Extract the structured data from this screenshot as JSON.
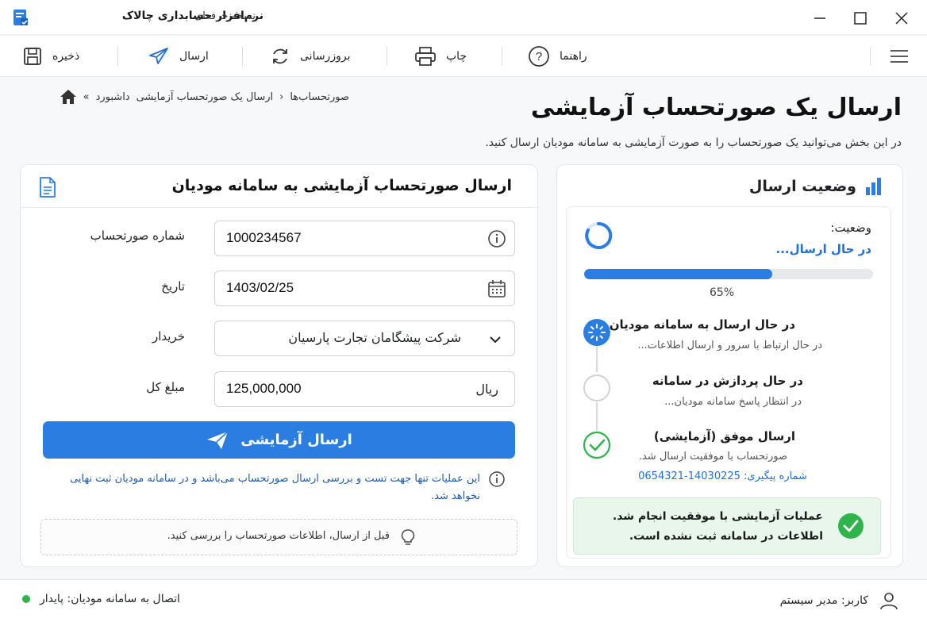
{
  "window": {
    "title": "نرم‌افزار حسابداری چالاک",
    "edition": "نسخه حرفه‌ای"
  },
  "toolbar": {
    "save": "ذخیره",
    "send": "ارسال",
    "update": "بروزرسانی",
    "print": "چاپ",
    "help": "راهنما"
  },
  "breadcrumb": {
    "items": [
      "داشبورد",
      "صورتحساب‌ها",
      "ارسال یک صورتحساب آزمایشی"
    ]
  },
  "page": {
    "title": "ارسال یک صورتحساب آزمایشی",
    "subtitle": "در این بخش می‌توانید یک صورتحساب را به صورت آزمایشی به سامانه مودیان ارسال کنید."
  },
  "form": {
    "title": "ارسال صورتحساب آزمایشی به سامانه مودیان",
    "invoice_number_label": "شماره صورتحساب",
    "invoice_number_value": "1000234567",
    "date_label": "تاریخ",
    "date_value": "1403/02/25",
    "buyer_label": "خریدار",
    "buyer_value": "شرکت پیشگامان تجارت پارسیان",
    "amount_label": "مبلغ کل",
    "amount_value": "125,000,000",
    "amount_unit": "ریال",
    "send_button": "ارسال آزمایشی",
    "note": "این عملیات تنها جهت تست و بررسی ارسال صورتحساب می‌باشد و در سامانه مودیان ثبت نهایی نخواهد شد.",
    "tip": "قبل از ارسال، اطلاعات صورتحساب را بررسی کنید."
  },
  "status": {
    "title": "وضعیت ارسال",
    "label": "وضعیت:",
    "value": "در حال ارسال...",
    "progress": 0.65,
    "progress_text": "65%",
    "steps": [
      {
        "title": "در حال ارسال به سامانه مودیان",
        "desc": "در حال ارتباط با سرور و ارسال اطلاعات...",
        "state": "active"
      },
      {
        "title": "در حال پردازش در سامانه",
        "desc": "در انتظار پاسخ سامانه مودیان...",
        "state": "pending"
      },
      {
        "title": "ارسال موفق (آزمایشی)",
        "desc": "صورتحساب با موفقیت ارسال شد.",
        "tracking": "شماره پیگیری: 14030225-0654321",
        "state": "done"
      }
    ],
    "success_line1": "عملیات آزمایشی با موفقیت انجام شد.",
    "success_line2": "اطلاعات در سامانه ثبت نشده است."
  },
  "statusbar": {
    "connection": "اتصال به سامانه مودیان: پایدار",
    "user": "کاربر: مدیر سیستم"
  },
  "colors": {
    "accent": "#2a7de1",
    "success": "#2fb34b",
    "link": "#1f6fd6"
  }
}
